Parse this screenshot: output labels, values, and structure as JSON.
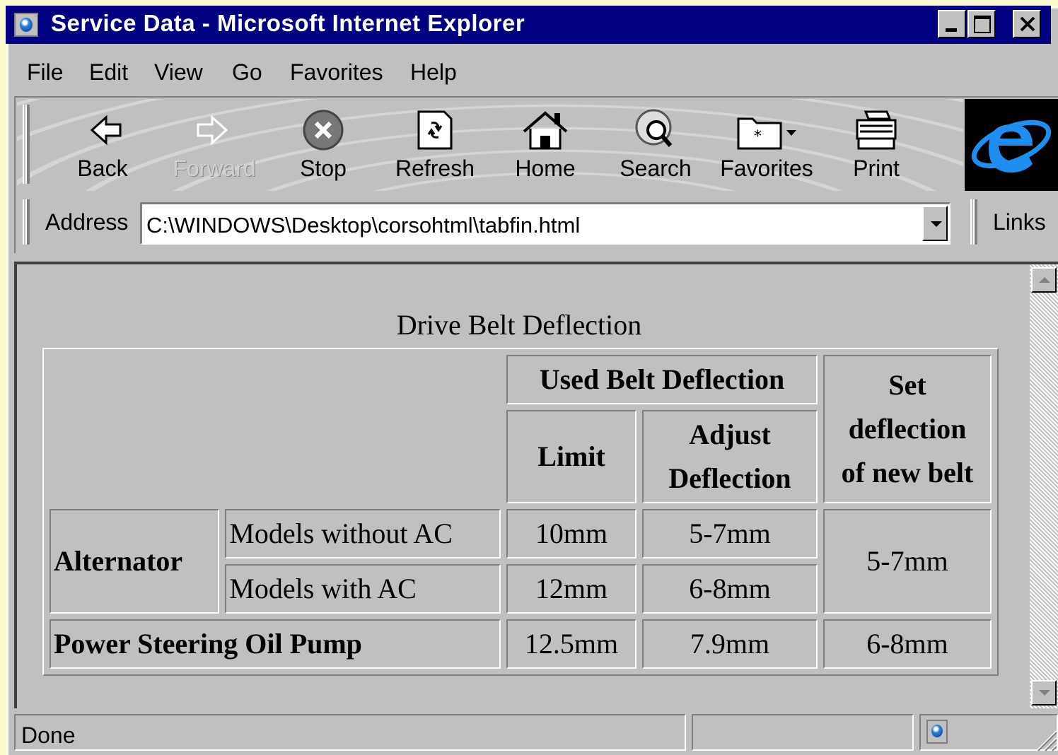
{
  "window": {
    "title": "Service Data - Microsoft Internet Explorer"
  },
  "menu": {
    "file": "File",
    "edit": "Edit",
    "view": "View",
    "go": "Go",
    "favorites": "Favorites",
    "help": "Help"
  },
  "toolbar": {
    "back": "Back",
    "forward": "Forward",
    "stop": "Stop",
    "refresh": "Refresh",
    "home": "Home",
    "search": "Search",
    "favorites": "Favorites",
    "print": "Print"
  },
  "address": {
    "label": "Address",
    "url": "C:\\WINDOWS\\Desktop\\corsohtml\\tabfin.html",
    "links_label": "Links"
  },
  "page": {
    "caption": "Drive Belt Deflection",
    "header": {
      "used_belt": "Used Belt Deflection",
      "limit": "Limit",
      "adjust_line1": "Adjust",
      "adjust_line2": "Deflection",
      "set_line1": "Set",
      "set_line2": "deflection",
      "set_line3": "of new belt"
    },
    "rows": {
      "alternator": "Alternator",
      "without_ac": "Models without AC",
      "with_ac": "Models with AC",
      "power_steering": "Power Steering Oil Pump"
    },
    "values": {
      "without_ac_limit": "10mm",
      "without_ac_adjust": "5-7mm",
      "with_ac_limit": "12mm",
      "with_ac_adjust": "6-8mm",
      "alternator_new": "5-7mm",
      "ps_limit": "12.5mm",
      "ps_adjust": "7.9mm",
      "ps_new": "6-8mm"
    }
  },
  "status": {
    "text": "Done"
  },
  "colors": {
    "titlebar": "#000080",
    "chrome": "#c0c0c0",
    "desktop": "#fbf9cf"
  }
}
